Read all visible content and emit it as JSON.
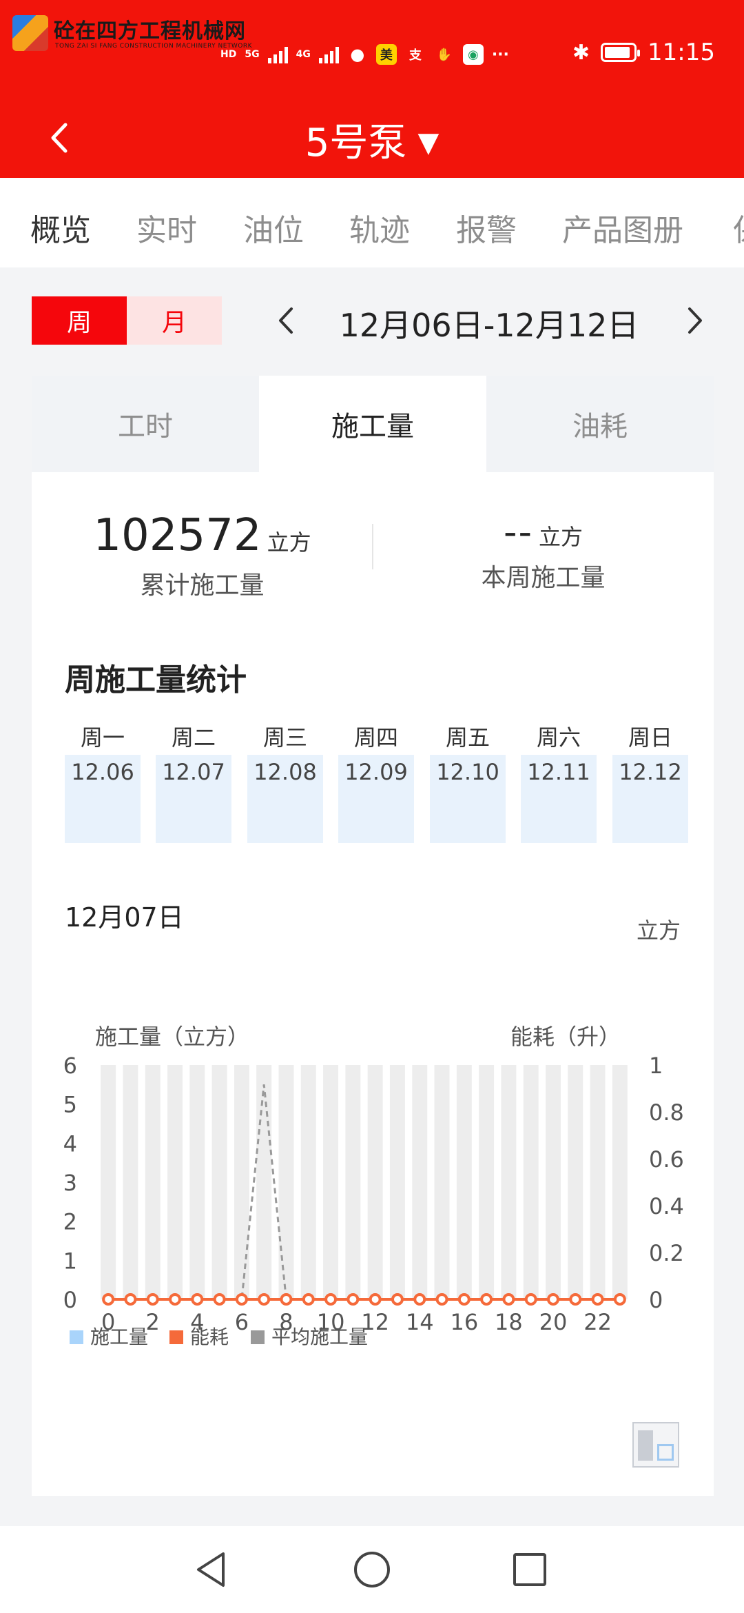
{
  "status_bar": {
    "logo_text": "砼在四方工程机械网",
    "logo_subtext": "TONG ZAI SI FANG CONSTRUCTION MACHINERY NETWORK",
    "hd_label": "HD",
    "net_5g": "5G",
    "net_4g": "4G",
    "app_icon_mei": "美",
    "app_icon_zhi": "支",
    "more": "···",
    "time": "11:15"
  },
  "header": {
    "title": "5号泵",
    "caret": "▼"
  },
  "tabs": [
    {
      "label": "概览",
      "active": true
    },
    {
      "label": "实时",
      "active": false
    },
    {
      "label": "油位",
      "active": false
    },
    {
      "label": "轨迹",
      "active": false
    },
    {
      "label": "报警",
      "active": false
    },
    {
      "label": "产品图册",
      "active": false
    },
    {
      "label": "保",
      "active": false
    }
  ],
  "period": {
    "week_label": "周",
    "month_label": "月",
    "range": "12月06日-12月12日"
  },
  "subtabs": [
    {
      "label": "工时",
      "active": false
    },
    {
      "label": "施工量",
      "active": true
    },
    {
      "label": "油耗",
      "active": false
    }
  ],
  "stats": {
    "total_value": "102572",
    "total_unit": "立方",
    "total_label": "累计施工量",
    "week_value": "--",
    "week_unit": "立方",
    "week_label": "本周施工量"
  },
  "week_section": {
    "title": "周施工量统计",
    "days": [
      {
        "name": "周一",
        "date": "12.06"
      },
      {
        "name": "周二",
        "date": "12.07"
      },
      {
        "name": "周三",
        "date": "12.08"
      },
      {
        "name": "周四",
        "date": "12.09"
      },
      {
        "name": "周五",
        "date": "12.10"
      },
      {
        "name": "周六",
        "date": "12.11"
      },
      {
        "name": "周日",
        "date": "12.12"
      }
    ]
  },
  "chart_header": {
    "date": "12月07日",
    "unit": "立方"
  },
  "colors": {
    "brand_red": "#f2140b",
    "bar_blue": "#a9d4fb",
    "energy_orange": "#f56a3a",
    "avg_gray": "#999999"
  },
  "chart_data": {
    "type": "bar",
    "ylabel_left": "施工量（立方）",
    "ylabel_right": "能耗（升）",
    "x": [
      0,
      1,
      2,
      3,
      4,
      5,
      6,
      7,
      8,
      9,
      10,
      11,
      12,
      13,
      14,
      15,
      16,
      17,
      18,
      19,
      20,
      21,
      22,
      23
    ],
    "x_tick_labels": [
      "0",
      "2",
      "4",
      "6",
      "8",
      "10",
      "12",
      "14",
      "16",
      "18",
      "20",
      "22"
    ],
    "ylim_left": [
      0,
      6
    ],
    "yticks_left": [
      "0",
      "1",
      "2",
      "3",
      "4",
      "5",
      "6"
    ],
    "ylim_right": [
      0,
      1
    ],
    "yticks_right": [
      "0",
      "0.2",
      "0.4",
      "0.6",
      "0.8",
      "1"
    ],
    "grid": false,
    "legend_position": "bottom-left",
    "series": [
      {
        "name": "施工量",
        "kind": "bar",
        "values": [
          0,
          0,
          0,
          0,
          0,
          0,
          0,
          0,
          0,
          0,
          0,
          0,
          0,
          0,
          0,
          0,
          0,
          0,
          0,
          0,
          0,
          0,
          0,
          0
        ]
      },
      {
        "name": "能耗",
        "kind": "line",
        "values": [
          0,
          0,
          0,
          0,
          0,
          0,
          0,
          0,
          0,
          0,
          0,
          0,
          0,
          0,
          0,
          0,
          0,
          0,
          0,
          0,
          0,
          0,
          0,
          0
        ]
      },
      {
        "name": "平均施工量",
        "kind": "dashed-line",
        "values": [
          0,
          0,
          0,
          0,
          0,
          0,
          0,
          5.5,
          0,
          0,
          0,
          0,
          0,
          0,
          0,
          0,
          0,
          0,
          0,
          0,
          0,
          0,
          0,
          0
        ]
      }
    ]
  }
}
